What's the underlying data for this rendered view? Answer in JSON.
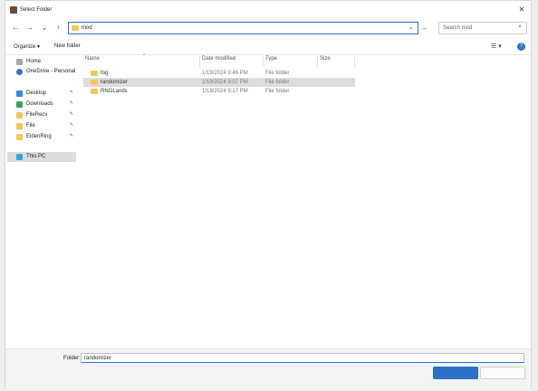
{
  "window": {
    "title": "Select Folder",
    "close_icon": "close-icon"
  },
  "nav": {
    "back": "←",
    "forward": "→",
    "recent": "⌄",
    "up": "↑",
    "address_path": "mod",
    "refresh": "→",
    "search_placeholder": "Search mod",
    "search_icon": "⌕"
  },
  "toolbar": {
    "organize": "Organize ▾",
    "new_folder": "New folder",
    "view": "☰ ▾",
    "help": "?"
  },
  "sidebar": {
    "items": [
      {
        "label": "Home",
        "pin": ""
      },
      {
        "label": "OneDrive - Personal",
        "pin": ""
      },
      {
        "label": "Desktop",
        "pin": "✎"
      },
      {
        "label": "Downloads",
        "pin": "✎"
      },
      {
        "label": "FileRecv",
        "pin": "✎"
      },
      {
        "label": "File",
        "pin": "✎"
      },
      {
        "label": "EldenRing",
        "pin": "✎"
      },
      {
        "label": "This PC",
        "pin": ""
      }
    ]
  },
  "columns": {
    "name": "Name",
    "date": "Date modified",
    "type": "Type",
    "size": "Size",
    "sort": "^"
  },
  "files": [
    {
      "name": "fog",
      "date": "1/19/2024 9:46 PM",
      "type": "File folder"
    },
    {
      "name": "randomizer",
      "date": "1/19/2024 9:07 PM",
      "type": "File folder"
    },
    {
      "name": "RNGLands",
      "date": "1/19/2024 9:17 PM",
      "type": "File folder"
    }
  ],
  "folder_field": {
    "label": "Folder:",
    "value": "randomizer"
  },
  "colors": {
    "accent": "#2b73c6",
    "folder": "#f3c65c",
    "selection": "#dcdcdc"
  }
}
